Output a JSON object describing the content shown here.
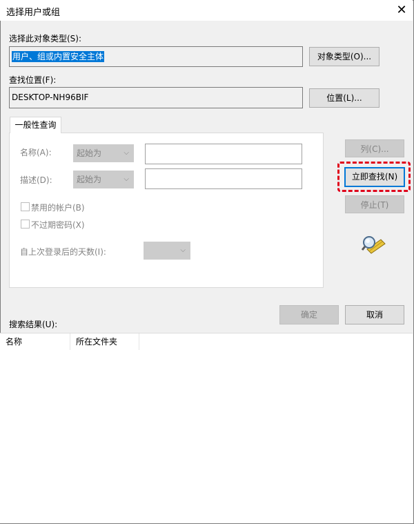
{
  "window": {
    "title": "选择用户或组",
    "close_glyph": "✕"
  },
  "object_type": {
    "label": "选择此对象类型(S):",
    "value": "用户、组或内置安全主体",
    "button": "对象类型(O)..."
  },
  "location": {
    "label": "查找位置(F):",
    "value": "DESKTOP-NH96BIF",
    "button": "位置(L)..."
  },
  "query": {
    "tab_label": "一般性查询",
    "name_label": "名称(A):",
    "name_mode": "起始为",
    "desc_label": "描述(D):",
    "desc_mode": "起始为",
    "disabled_accounts_label": "禁用的帐户(B)",
    "non_expiring_pw_label": "不过期密码(X)",
    "days_since_login_label": "自上次登录后的天数(I):"
  },
  "side_buttons": {
    "columns": "列(C)...",
    "find_now": "立即查找(N)",
    "stop": "停止(T)"
  },
  "dialog_buttons": {
    "ok": "确定",
    "cancel": "取消"
  },
  "results": {
    "label": "搜索结果(U):",
    "columns": [
      "名称",
      "所在文件夹"
    ]
  },
  "colors": {
    "highlight": "#e0001a",
    "selection": "#0078d7"
  }
}
